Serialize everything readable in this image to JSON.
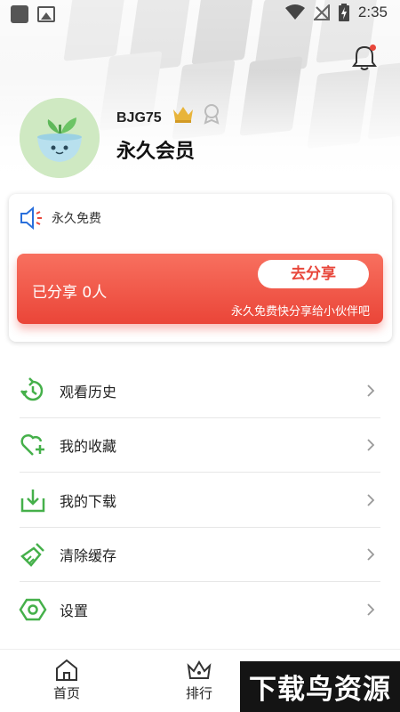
{
  "status_bar": {
    "time": "2:35"
  },
  "profile": {
    "username": "BJG75",
    "membership": "永久会员"
  },
  "share_card": {
    "notice": "永久免费",
    "shared_count": "已分享 0人",
    "share_button": "去分享",
    "subtitle": "永久免费快分享给小伙伴吧"
  },
  "menu": [
    {
      "label": "观看历史",
      "icon": "history-icon"
    },
    {
      "label": "我的收藏",
      "icon": "heart-plus-icon"
    },
    {
      "label": "我的下载",
      "icon": "download-icon"
    },
    {
      "label": "清除缓存",
      "icon": "broom-icon"
    },
    {
      "label": "设置",
      "icon": "settings-icon"
    }
  ],
  "bottom_nav": [
    {
      "label": "首页",
      "icon": "home-icon"
    },
    {
      "label": "排行",
      "icon": "ranking-icon"
    }
  ],
  "watermark": "下载鸟资源",
  "colors": {
    "accent_green": "#45b04a",
    "share_red": "#ea4538",
    "notice_blue": "#2a6fdb"
  }
}
